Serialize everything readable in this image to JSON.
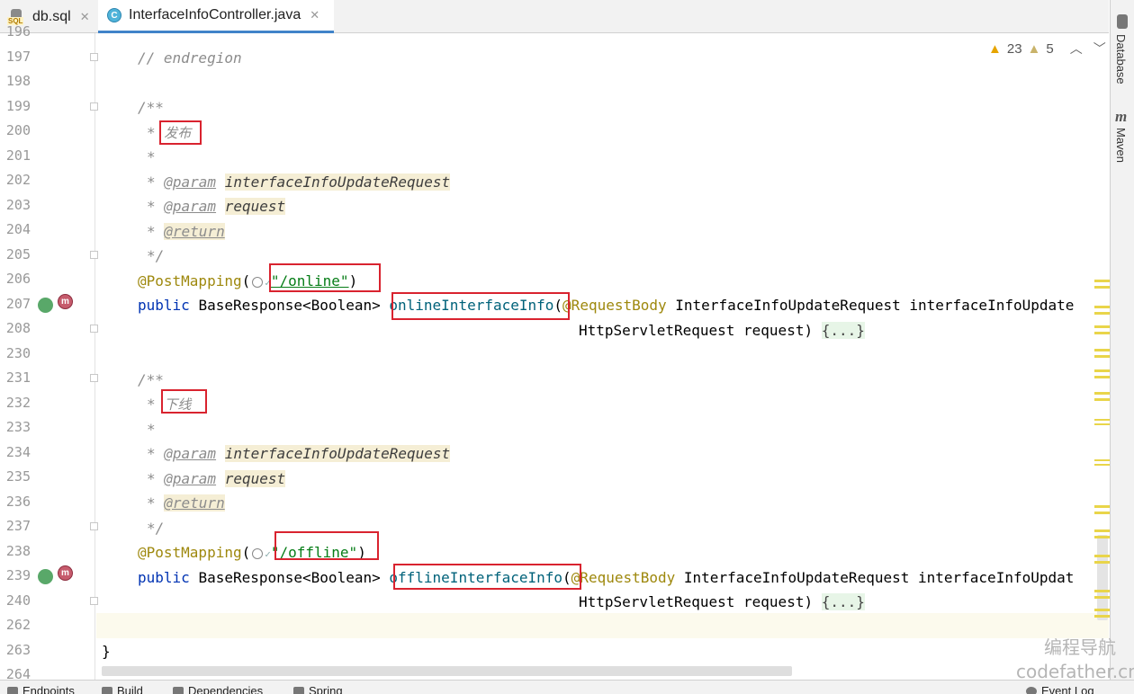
{
  "tabs": [
    {
      "label": "db.sql",
      "icon": "sql-file-icon"
    },
    {
      "label": "InterfaceInfoController.java",
      "icon": "java-class-icon",
      "icon_letter": "C"
    }
  ],
  "gutter": {
    "line_numbers": [
      "196",
      "197",
      "198",
      "199",
      "200",
      "201",
      "202",
      "203",
      "204",
      "205",
      "206",
      "207",
      "208",
      "230",
      "231",
      "232",
      "233",
      "234",
      "235",
      "236",
      "237",
      "238",
      "239",
      "240",
      "262",
      "263",
      "264"
    ]
  },
  "code": {
    "l197": "// endregion",
    "l199": "/**",
    "l200_star": "* ",
    "l200_text": "发布",
    "l201": "*",
    "l202_star": "* ",
    "l202_tag": "@param",
    "l202_name": "interfaceInfoUpdateRequest",
    "l203_star": "* ",
    "l203_tag": "@param",
    "l203_name": "request",
    "l204_star": "* ",
    "l204_tag": "@return",
    "l205": "*/",
    "l206_ann": "@PostMapping",
    "l206_open": "(",
    "l206_str": "\"/online\"",
    "l206_close": ")",
    "l207_kw": "public",
    "l207_type": "BaseResponse<Boolean>",
    "l207_method": "onlineInterfaceInfo",
    "l207_paren": "(",
    "l207_ann": "@RequestBody",
    "l207_rest": "InterfaceInfoUpdateRequest interfaceInfoUpdate",
    "l208_params": "HttpServletRequest request)",
    "l208_fold": "{...}",
    "l231": "/**",
    "l232_star": "* ",
    "l232_text": "下线",
    "l233": "*",
    "l234_star": "* ",
    "l234_tag": "@param",
    "l234_name": "interfaceInfoUpdateRequest",
    "l235_star": "* ",
    "l235_tag": "@param",
    "l235_name": "request",
    "l236_star": "* ",
    "l236_tag": "@return",
    "l237": "*/",
    "l238_ann": "@PostMapping",
    "l238_open": "(",
    "l238_str": "\"/offline\"",
    "l238_close": ")",
    "l239_kw": "public",
    "l239_type": "BaseResponse<Boolean>",
    "l239_method": "offlineInterfaceInfo",
    "l239_paren": "(",
    "l239_ann": "@RequestBody",
    "l239_rest": "InterfaceInfoUpdateRequest interfaceInfoUpdat",
    "l240_params": "HttpServletRequest request)",
    "l240_fold": "{...}",
    "l263": "}"
  },
  "inspections": {
    "warnings": "23",
    "weak_warnings": "5"
  },
  "right_tools": [
    "Database",
    "Maven"
  ],
  "bottom_tools": [
    "Endpoints",
    "Build",
    "Dependencies",
    "Spring",
    "Event Log"
  ],
  "watermark": {
    "line1": "编程导航",
    "line2": "codefather.cn"
  },
  "colors": {
    "keyword": "#0033b3",
    "annotation": "#9e880d",
    "string": "#067d17",
    "method": "#00627a",
    "comment": "#8c8c8c",
    "highlight_box": "#d9232f",
    "active_tab_underline": "#4083c9"
  }
}
